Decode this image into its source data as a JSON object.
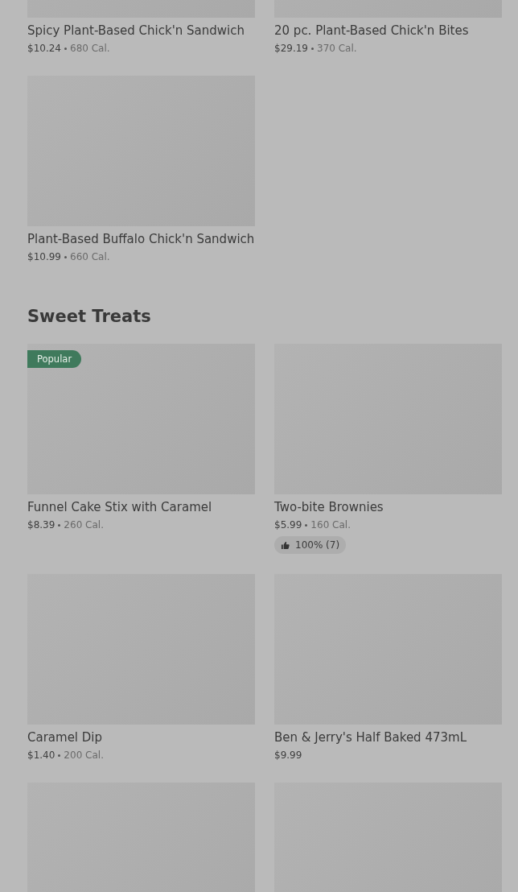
{
  "sections": [
    {
      "items": [
        {
          "kind": "item",
          "name": "Spicy Plant-Based Chick'n Sandwich",
          "price": "$10.24",
          "calories": "680 Cal."
        },
        {
          "kind": "item",
          "name": "20 pc. Plant-Based Chick'n Bites",
          "price": "$29.19",
          "calories": "370 Cal."
        },
        {
          "kind": "item",
          "name": "Plant-Based Buffalo Chick'n Sandwich",
          "price": "$10.99",
          "calories": "660 Cal."
        }
      ]
    },
    {
      "title": "Sweet Treats",
      "items": [
        {
          "kind": "item",
          "name": "Funnel Cake Stix with Caramel",
          "price": "$8.39",
          "calories": "260 Cal.",
          "badge": "Popular"
        },
        {
          "kind": "item",
          "name": "Two-bite Brownies",
          "price": "$5.99",
          "calories": "160 Cal.",
          "rating": "100% (7)"
        },
        {
          "kind": "item",
          "name": "Caramel Dip",
          "price": "$1.40",
          "calories": "200 Cal."
        },
        {
          "kind": "item",
          "name": "Ben & Jerry's Half Baked 473mL",
          "price": "$9.99"
        },
        {
          "kind": "picture"
        },
        {
          "kind": "picture"
        }
      ]
    }
  ]
}
